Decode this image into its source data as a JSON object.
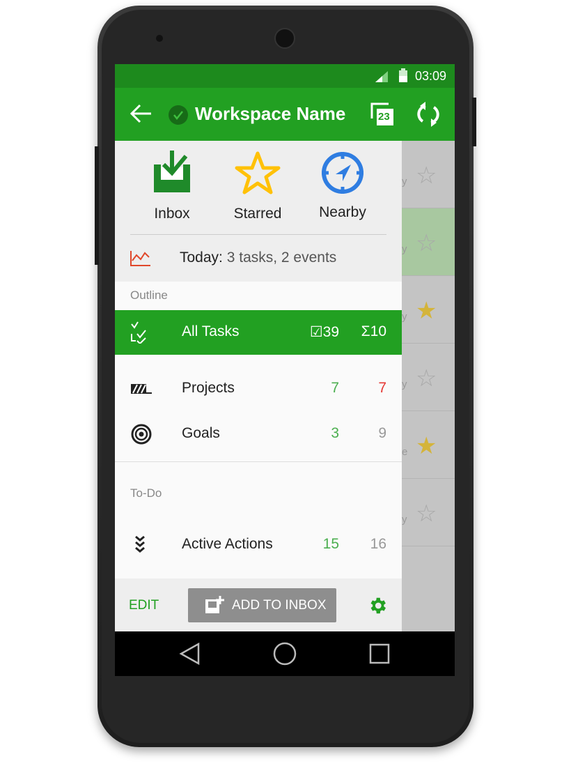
{
  "status_bar": {
    "time": "03:09"
  },
  "app_bar": {
    "title": "Workspace Name",
    "calendar_day": "23"
  },
  "quick_access": [
    {
      "label": "Inbox",
      "icon": "inbox-download-icon"
    },
    {
      "label": "Starred",
      "icon": "star-icon"
    },
    {
      "label": "Nearby",
      "icon": "compass-icon"
    }
  ],
  "today": {
    "label": "Today:",
    "summary": "3 tasks, 2 events"
  },
  "sections": {
    "outline": "Outline",
    "todo": "To-Do"
  },
  "items": [
    {
      "label": "All Tasks",
      "count1": "39",
      "count2": "10",
      "selected": true
    },
    {
      "label": "Projects",
      "count1": "7",
      "count2": "7"
    },
    {
      "label": "Goals",
      "count1": "3",
      "count2": "9"
    },
    {
      "label": "Active Actions",
      "count1": "15",
      "count2": "16"
    }
  ],
  "bottom_bar": {
    "edit": "EDIT",
    "add_to_inbox": "ADD TO INBOX"
  },
  "background_list": {
    "fragments": [
      "y",
      "y",
      "y",
      "y",
      "e",
      "y"
    ],
    "starred": [
      false,
      false,
      true,
      false,
      true,
      false
    ]
  },
  "colors": {
    "primary": "#22a022",
    "status_bar": "#1d8a1d",
    "star": "#ffc107",
    "nearby": "#2f7de1",
    "projects_overdue": "#e53935"
  }
}
